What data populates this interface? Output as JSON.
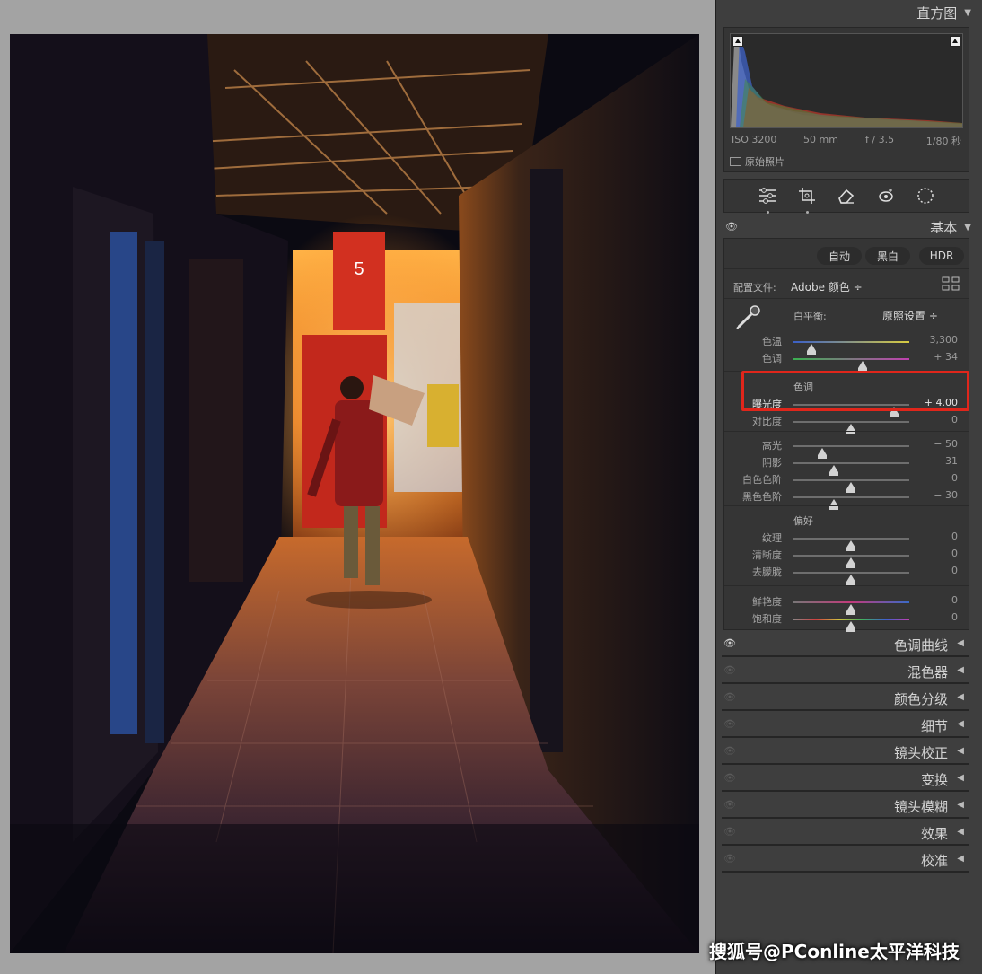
{
  "histogram": {
    "title": "直方图",
    "iso": "ISO 3200",
    "focal": "50 mm",
    "aperture": "f / 3.5",
    "shutter": "1/80 秒",
    "original_photo": "原始照片"
  },
  "tools": [
    "sliders-icon",
    "crop-icon",
    "eraser-icon",
    "redeye-icon",
    "mask-icon"
  ],
  "basic": {
    "title": "基本",
    "buttons": {
      "auto": "自动",
      "bw": "黑白",
      "hdr": "HDR"
    },
    "profile_label": "配置文件:",
    "profile_value": "Adobe 颜色 ÷",
    "wb_label": "白平衡:",
    "wb_value": "原照设置 ÷",
    "temp": {
      "name": "色温",
      "value": "3,300",
      "pos": 0.16
    },
    "tint": {
      "name": "色调",
      "value": "+ 34",
      "pos": 0.6
    },
    "tone_heading": "色调",
    "exposure": {
      "name": "曝光度",
      "value": "+ 4.00",
      "pos": 0.87
    },
    "contrast": {
      "name": "对比度",
      "value": "0",
      "pos": 0.5
    },
    "highlights": {
      "name": "高光",
      "value": "− 50",
      "pos": 0.25
    },
    "shadows": {
      "name": "阴影",
      "value": "− 31",
      "pos": 0.35
    },
    "whites": {
      "name": "白色色阶",
      "value": "0",
      "pos": 0.5
    },
    "blacks": {
      "name": "黑色色阶",
      "value": "− 30",
      "pos": 0.35
    },
    "presence_heading": "偏好",
    "texture": {
      "name": "纹理",
      "value": "0",
      "pos": 0.5
    },
    "clarity": {
      "name": "清晰度",
      "value": "0",
      "pos": 0.5
    },
    "dehaze": {
      "name": "去朦胧",
      "value": "0",
      "pos": 0.5
    },
    "vibrance": {
      "name": "鲜艳度",
      "value": "0",
      "pos": 0.5
    },
    "saturation": {
      "name": "饱和度",
      "value": "0",
      "pos": 0.5
    }
  },
  "collapsed_panels": [
    "色调曲线",
    "混色器",
    "颜色分级",
    "细节",
    "镜头校正",
    "变换",
    "镜头模糊",
    "效果",
    "校准"
  ],
  "watermark": "搜狐号@PConline太平洋科技",
  "colors": {
    "accent_red": "#e0261b",
    "panel_bg": "#3e3e3e",
    "stage_bg": "#a3a3a3"
  }
}
